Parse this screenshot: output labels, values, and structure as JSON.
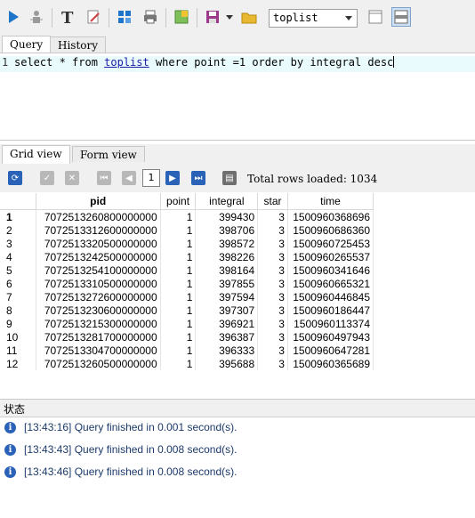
{
  "toolbar": {
    "database_select_value": "toplist",
    "buttons": [
      "run",
      "stop",
      "text",
      "edit",
      "settings",
      "print",
      "export",
      "save",
      "open",
      "view-single",
      "view-split"
    ]
  },
  "tabs": {
    "query": "Query",
    "history": "History"
  },
  "editor": {
    "line_number": "1",
    "sql_before": "select * from ",
    "sql_table": "toplist",
    "sql_after": " where point =1 order by integral desc"
  },
  "grid_tabs": {
    "grid_view": "Grid view",
    "form_view": "Form view"
  },
  "grid_tools": {
    "page": "1",
    "rows_loaded": "Total rows loaded: 1034"
  },
  "grid": {
    "columns": [
      "",
      "pid",
      "point",
      "integral",
      "star",
      "time"
    ],
    "rows": [
      [
        "1",
        "7072513260800000000",
        "1",
        "399430",
        "3",
        "1500960368696"
      ],
      [
        "2",
        "7072513312600000000",
        "1",
        "398706",
        "3",
        "1500960686360"
      ],
      [
        "3",
        "7072513320500000000",
        "1",
        "398572",
        "3",
        "1500960725453"
      ],
      [
        "4",
        "7072513242500000000",
        "1",
        "398226",
        "3",
        "1500960265537"
      ],
      [
        "5",
        "7072513254100000000",
        "1",
        "398164",
        "3",
        "1500960341646"
      ],
      [
        "6",
        "7072513310500000000",
        "1",
        "397855",
        "3",
        "1500960665321"
      ],
      [
        "7",
        "7072513272600000000",
        "1",
        "397594",
        "3",
        "1500960446845"
      ],
      [
        "8",
        "7072513230600000000",
        "1",
        "397307",
        "3",
        "1500960186447"
      ],
      [
        "9",
        "7072513215300000000",
        "1",
        "396921",
        "3",
        "1500960113374"
      ],
      [
        "10",
        "7072513281700000000",
        "1",
        "396387",
        "3",
        "1500960497943"
      ],
      [
        "11",
        "7072513304700000000",
        "1",
        "396333",
        "3",
        "1500960647281"
      ],
      [
        "12",
        "7072513260500000000",
        "1",
        "395688",
        "3",
        "1500960365689"
      ]
    ]
  },
  "status": {
    "title": "状态",
    "messages": [
      "[13:43:16]  Query finished in 0.001 second(s).",
      "[13:43:43]  Query finished in 0.008 second(s).",
      "[13:43:46]  Query finished in 0.008 second(s)."
    ]
  },
  "colors": {
    "accent": "#2a62b8",
    "editor_line": "#e9fbfd",
    "message_text": "#1b3a6b"
  }
}
